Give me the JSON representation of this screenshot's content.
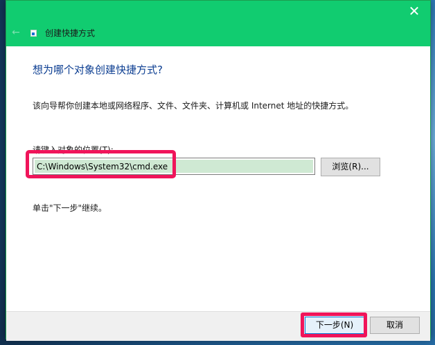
{
  "window": {
    "title": "创建快捷方式",
    "close_glyph": "✕",
    "back_glyph": "←"
  },
  "wizard": {
    "heading": "想为哪个对象创建快捷方式?",
    "description": "该向导帮你创建本地或网络程序、文件、文件夹、计算机或 Internet 地址的快捷方式。",
    "location_label": "请键入对象的位置(T):",
    "location_value": "C:\\Windows\\System32\\cmd.exe",
    "browse_label": "浏览(R)...",
    "hint": "单击\"下一步\"继续。"
  },
  "footer": {
    "next_label": "下一步(N)",
    "cancel_label": "取消"
  },
  "colors": {
    "titlebar": "#11cc70",
    "heading": "#0b3d91",
    "highlight": "#f0145a",
    "input_fill": "#cfe9d3"
  }
}
